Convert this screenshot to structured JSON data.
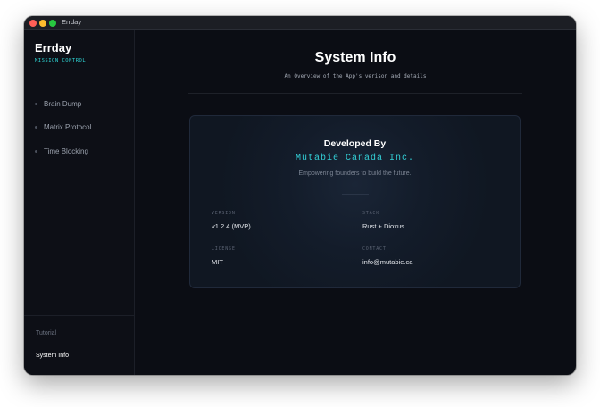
{
  "window": {
    "title": "Errday"
  },
  "sidebar": {
    "brand": "Errday",
    "brand_sub": "MISSION CONTROL",
    "items": [
      {
        "label": "Brain Dump"
      },
      {
        "label": "Matrix Protocol"
      },
      {
        "label": "Time Blocking"
      }
    ],
    "footer": [
      {
        "label": "Tutorial",
        "active": false
      },
      {
        "label": "System Info",
        "active": true
      }
    ]
  },
  "header": {
    "title": "System Info",
    "subtitle": "An Overview of the App's verison and details"
  },
  "card": {
    "title": "Developed By",
    "company": "Mutabie Canada Inc.",
    "tagline": "Empowering founders to build the future.",
    "fields": [
      {
        "label": "VERSION",
        "value": "v1.2.4 (MVP)"
      },
      {
        "label": "STACK",
        "value": "Rust + Dioxus"
      },
      {
        "label": "LICENSE",
        "value": "MIT"
      },
      {
        "label": "CONTACT",
        "value": "info@mutabie.ca"
      }
    ]
  },
  "colors": {
    "background": "#0b0d14",
    "accent": "#33d1d8",
    "text": "#ffffff"
  }
}
